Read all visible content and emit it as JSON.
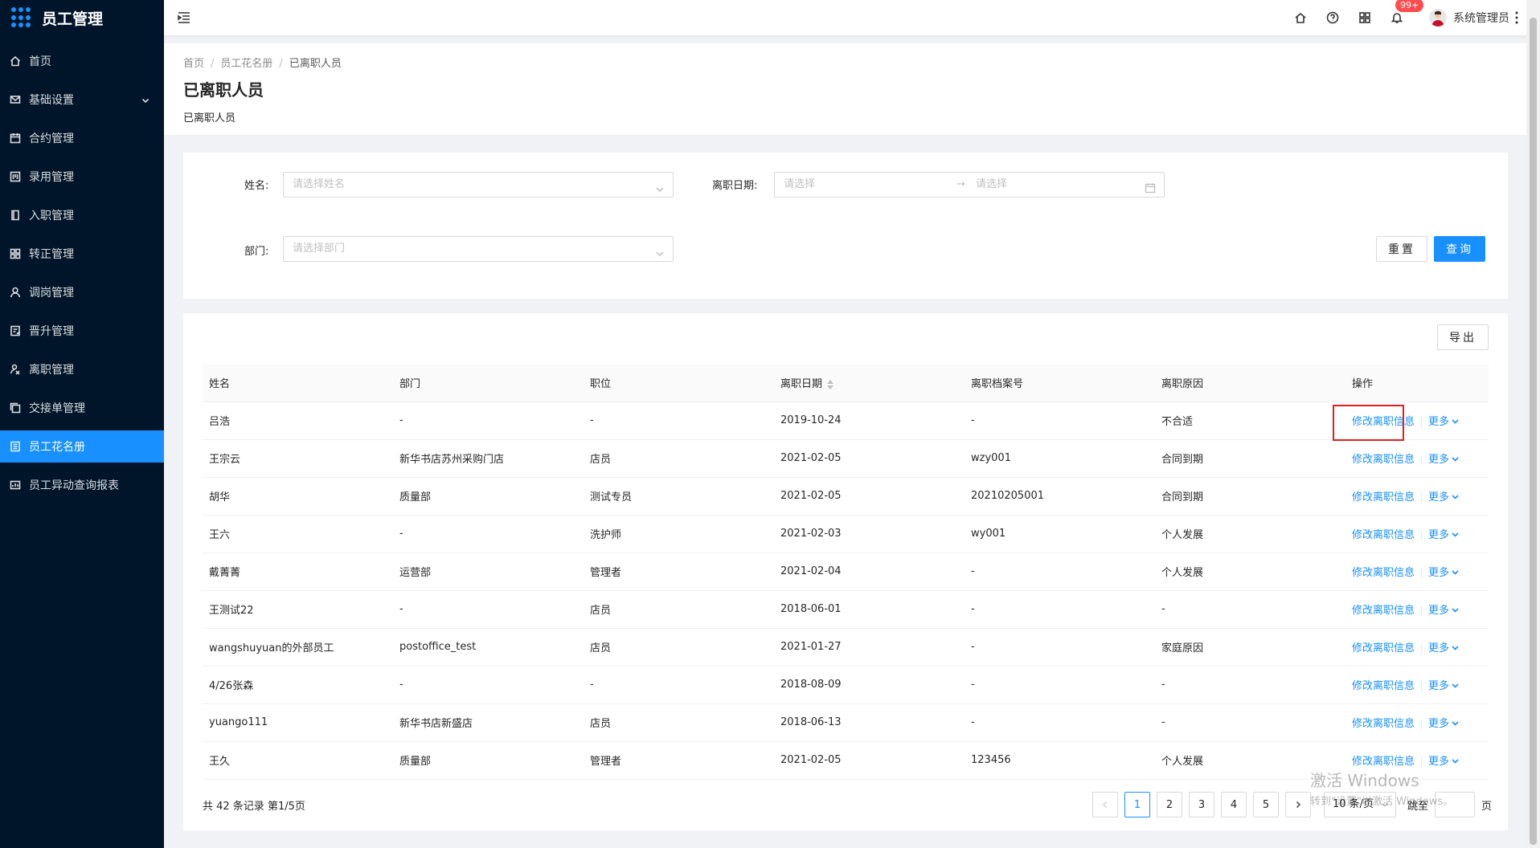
{
  "app": {
    "title": "员工管理"
  },
  "sidebar": {
    "items": [
      {
        "label": "首页",
        "icon": "home-icon"
      },
      {
        "label": "基础设置",
        "icon": "mail-icon",
        "expandable": true
      },
      {
        "label": "合约管理",
        "icon": "calendar-icon"
      },
      {
        "label": "录用管理",
        "icon": "board-icon"
      },
      {
        "label": "入职管理",
        "icon": "book-icon"
      },
      {
        "label": "转正管理",
        "icon": "grid-icon"
      },
      {
        "label": "调岗管理",
        "icon": "user-icon"
      },
      {
        "label": "晋升管理",
        "icon": "badge-icon"
      },
      {
        "label": "离职管理",
        "icon": "leave-icon"
      },
      {
        "label": "交接单管理",
        "icon": "copy-icon"
      },
      {
        "label": "员工花名册",
        "icon": "list-icon",
        "active": true
      },
      {
        "label": "员工异动查询报表",
        "icon": "report-icon"
      }
    ]
  },
  "header": {
    "badge": "99+",
    "user_name": "系统管理员"
  },
  "breadcrumb": [
    "首页",
    "员工花名册",
    "已离职人员"
  ],
  "page": {
    "title": "已离职人员",
    "subtitle": "已离职人员"
  },
  "filters": {
    "name_label": "姓名:",
    "name_placeholder": "请选择姓名",
    "date_label": "离职日期:",
    "date_start_placeholder": "请选择",
    "date_arrow": "→",
    "date_end_placeholder": "请选择",
    "dept_label": "部门:",
    "dept_placeholder": "请选择部门",
    "reset_label": "重置",
    "query_label": "查询"
  },
  "table": {
    "export_label": "导出",
    "columns": [
      "姓名",
      "部门",
      "职位",
      "离职日期",
      "离职档案号",
      "离职原因",
      "操作"
    ],
    "edit_label": "修改离职信息",
    "more_label": "更多",
    "rows": [
      [
        "吕浩",
        "-",
        "-",
        "2019-10-24",
        "-",
        "不合适"
      ],
      [
        "王宗云",
        "新华书店苏州采购门店",
        "店员",
        "2021-02-05",
        "wzy001",
        "合同到期"
      ],
      [
        "胡华",
        "质量部",
        "测试专员",
        "2021-02-05",
        "20210205001",
        "合同到期"
      ],
      [
        "王六",
        "-",
        "洗护师",
        "2021-02-03",
        "wy001",
        "个人发展"
      ],
      [
        "戴菁菁",
        "运营部",
        "管理者",
        "2021-02-04",
        "-",
        "个人发展"
      ],
      [
        "王测试22",
        "-",
        "店员",
        "2018-06-01",
        "-",
        "-"
      ],
      [
        "wangshuyuan的外部员工",
        "postoffice_test",
        "店员",
        "2021-01-27",
        "-",
        "家庭原因"
      ],
      [
        "4/26张森",
        "-",
        "-",
        "2018-08-09",
        "-",
        "-"
      ],
      [
        "yuango111",
        "新华书店新盛店",
        "店员",
        "2018-06-13",
        "-",
        "-"
      ],
      [
        "王久",
        "质量部",
        "管理者",
        "2021-02-05",
        "123456",
        "个人发展"
      ]
    ]
  },
  "pagination": {
    "total_text": "共 42 条记录 第1/5页",
    "pages": [
      "1",
      "2",
      "3",
      "4",
      "5"
    ],
    "current": "1",
    "page_size": "10 条/页",
    "jump_label": "跳至",
    "page_suffix": "页"
  },
  "watermark": {
    "line1": "激活 Windows",
    "line2": "转到\"设置\"以激活 Windows。"
  },
  "colors": {
    "sidebar_bg": "#001529",
    "primary": "#1890ff",
    "badge": "#ff4d4f",
    "highlight": "#e02020"
  }
}
